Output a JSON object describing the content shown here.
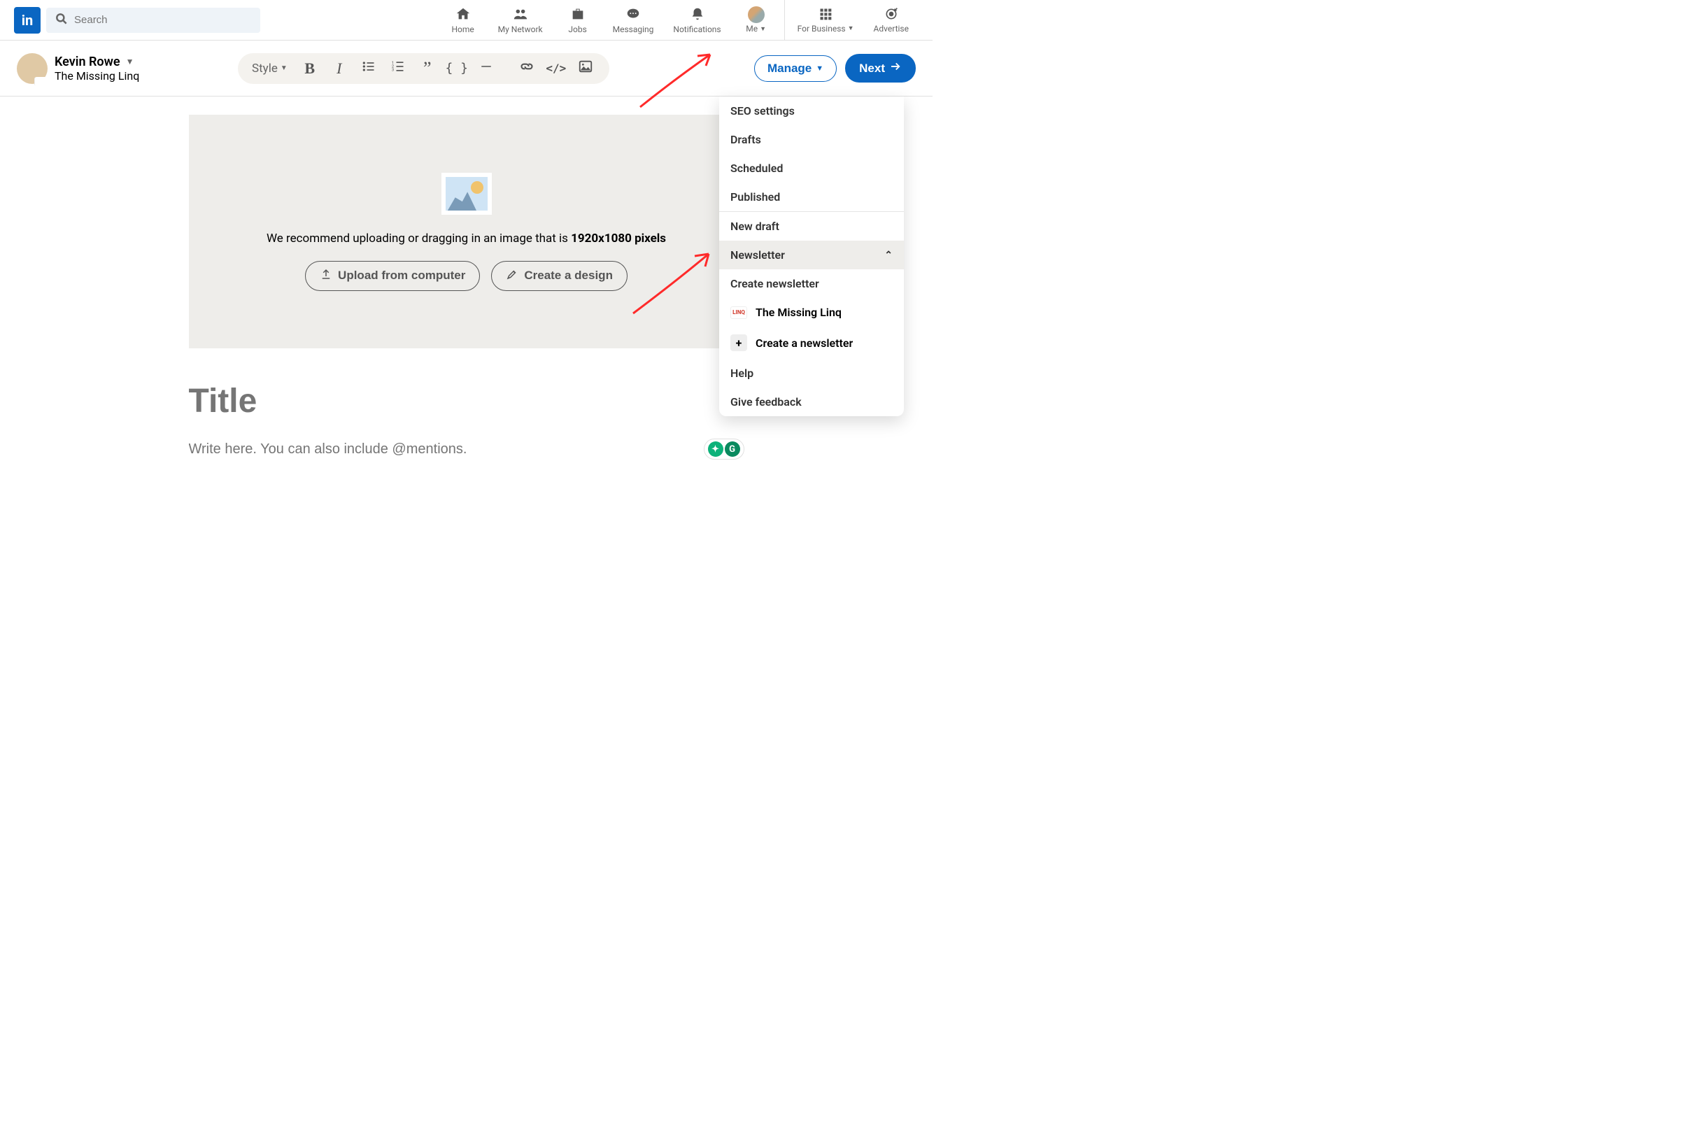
{
  "nav": {
    "search_placeholder": "Search",
    "items": {
      "home": "Home",
      "network": "My Network",
      "jobs": "Jobs",
      "messaging": "Messaging",
      "notifications": "Notifications",
      "me": "Me",
      "business": "For Business",
      "advertise": "Advertise"
    }
  },
  "author": {
    "name": "Kevin Rowe",
    "subtitle": "The Missing Linq",
    "badge": "LINQ"
  },
  "toolbar": {
    "style_label": "Style"
  },
  "actions": {
    "manage": "Manage",
    "next": "Next"
  },
  "uploader": {
    "text_pre": "We recommend uploading or dragging in an image that is ",
    "text_bold": "1920x1080 pixels",
    "btn_upload": "Upload from computer",
    "btn_design": "Create a design"
  },
  "editor": {
    "title_placeholder": "Title",
    "body_placeholder": "Write here. You can also include @mentions."
  },
  "dropdown": {
    "seo": "SEO settings",
    "drafts": "Drafts",
    "scheduled": "Scheduled",
    "published": "Published",
    "new_draft": "New draft",
    "newsletter": "Newsletter",
    "create_newsletter": "Create newsletter",
    "linq_label": "The Missing Linq",
    "create_a_newsletter": "Create a newsletter",
    "help": "Help",
    "feedback": "Give feedback"
  }
}
